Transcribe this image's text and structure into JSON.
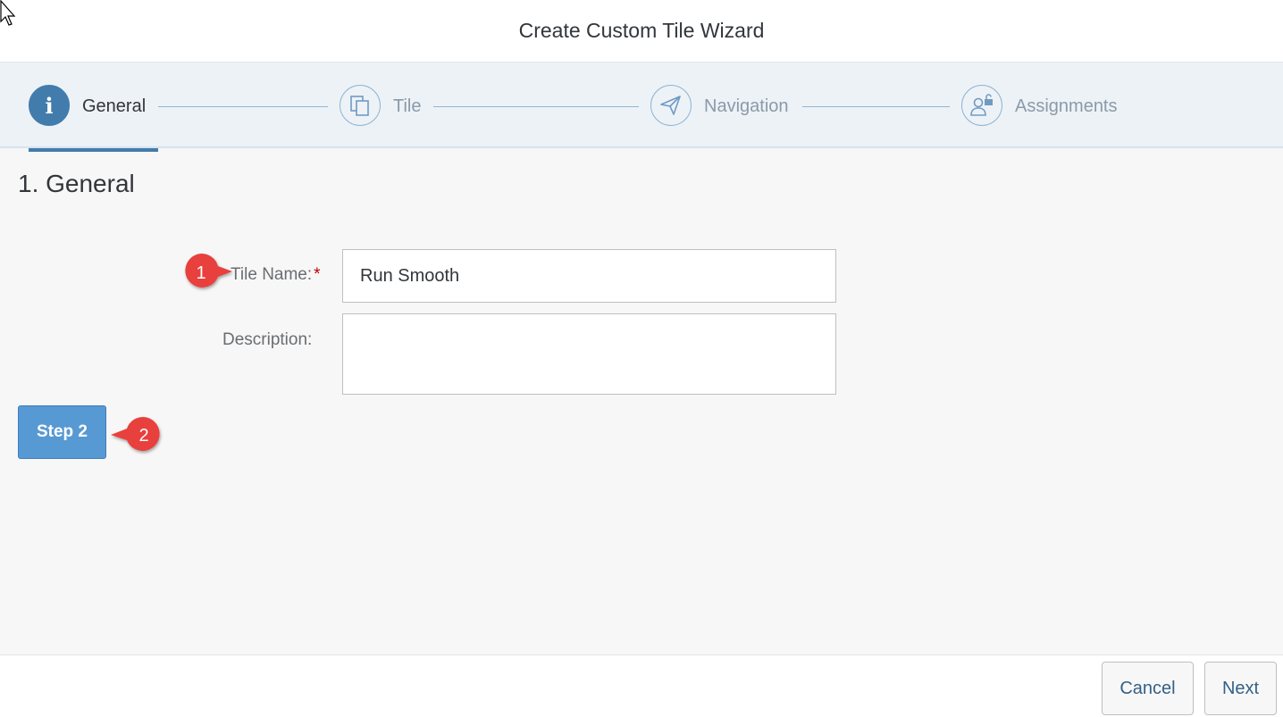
{
  "dialog": {
    "title": "Create Custom Tile Wizard"
  },
  "steps": [
    {
      "label": "General",
      "icon": "info-icon",
      "active": true
    },
    {
      "label": "Tile",
      "icon": "copy-icon",
      "active": false
    },
    {
      "label": "Navigation",
      "icon": "paper-plane-icon",
      "active": false
    },
    {
      "label": "Assignments",
      "icon": "user-lock-icon",
      "active": false
    }
  ],
  "section": {
    "title": "1. General"
  },
  "form": {
    "tile_name_label": "Tile Name:",
    "required_marker": "*",
    "tile_name_value": "Run Smooth",
    "description_label": "Description:",
    "description_value": ""
  },
  "step_button": {
    "label": "Step 2"
  },
  "callouts": [
    {
      "number": "1"
    },
    {
      "number": "2"
    }
  ],
  "footer": {
    "cancel_label": "Cancel",
    "next_label": "Next"
  },
  "colors": {
    "accent": "#427cac",
    "button": "#5799d3",
    "callout": "#e8413e"
  }
}
